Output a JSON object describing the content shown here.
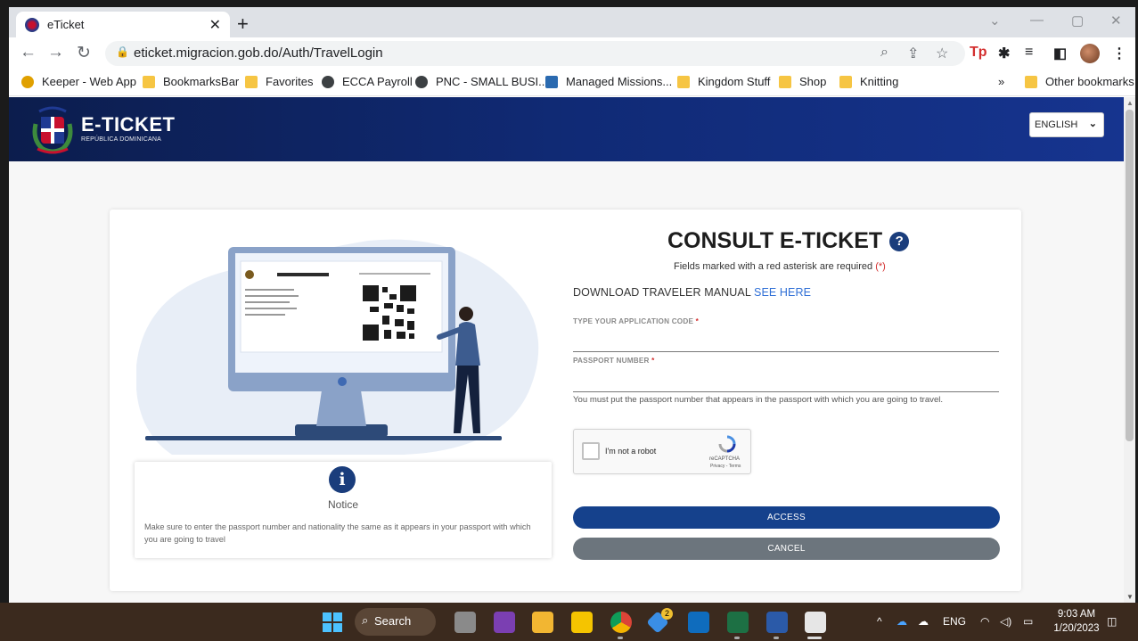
{
  "browser": {
    "tab_title": "eTicket",
    "url": "eticket.migracion.gob.do/Auth/TravelLogin",
    "bookmarks": [
      {
        "label": "Keeper - Web App",
        "icon": "keeper-icon"
      },
      {
        "label": "BookmarksBar",
        "icon": "folder-icon"
      },
      {
        "label": "Favorites",
        "icon": "folder-icon"
      },
      {
        "label": "ECCA Payroll",
        "icon": "globe-icon"
      },
      {
        "label": "PNC - SMALL BUSI...",
        "icon": "globe-icon"
      },
      {
        "label": "Managed Missions...",
        "icon": "missions-icon"
      },
      {
        "label": "Kingdom Stuff",
        "icon": "folder-icon"
      },
      {
        "label": "Shop",
        "icon": "folder-icon"
      },
      {
        "label": "Knitting",
        "icon": "folder-icon"
      }
    ],
    "overflow": "»",
    "other_bookmarks": "Other bookmarks"
  },
  "header": {
    "brand": "E-TICKET",
    "subtitle": "REPÚBLICA DOMINICANA",
    "language": "ENGLISH"
  },
  "notice": {
    "title": "Notice",
    "text": "Make sure to enter the passport number and nationality the same as it appears in your passport with which you are going to travel"
  },
  "illustration": {
    "doc_header": "REPUBLICA DOMINICANA"
  },
  "form": {
    "title": "CONSULT E-TICKET",
    "required_note": "Fields marked with a red asterisk are required",
    "required_mark": "(*)",
    "manual_text": "DOWNLOAD TRAVELER MANUAL",
    "manual_link": "SEE HERE",
    "app_code_label": "TYPE YOUR APPLICATION CODE",
    "app_code_value": "",
    "passport_label": "PASSPORT NUMBER",
    "passport_value": "",
    "asterisk": "*",
    "passport_hint": "You must put the passport number that appears in the passport with which you are going to travel.",
    "captcha_label": "I'm not a robot",
    "captcha_brand": "reCAPTCHA",
    "captcha_terms": "Privacy - Terms",
    "access": "ACCESS",
    "cancel": "CANCEL"
  },
  "taskbar": {
    "search": "Search",
    "language": "ENG",
    "time": "9:03 AM",
    "date": "1/20/2023",
    "badge_count": "2"
  },
  "colors": {
    "header": "#102a75",
    "access": "#15418c",
    "cancel": "#6c757d",
    "link": "#2f6fd6",
    "required": "#d32f2f"
  }
}
